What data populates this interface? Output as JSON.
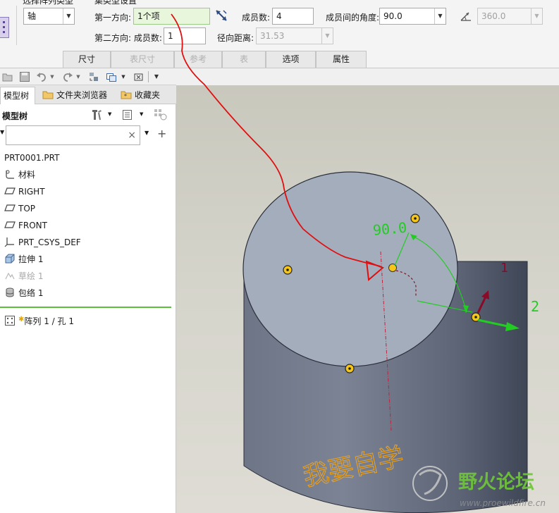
{
  "dashboard": {
    "pattern_type_label": "选择阵列类型",
    "pattern_type_value": "轴",
    "set_type_label": "集类型设置",
    "dir1_label": "第一方向:",
    "dir1_value": "1个项",
    "members_label": "成员数:",
    "members_value": "4",
    "angle_between_label": "成员间的角度:",
    "angle_between_value": "90.0",
    "total_angle_value": "360.0",
    "dir2_label": "第二方向: 成员数:",
    "dir2_members_value": "1",
    "radial_label": "径向距离:",
    "radial_value": "31.53",
    "tabs": [
      {
        "label": "尺寸",
        "enabled": true
      },
      {
        "label": "表尺寸",
        "enabled": false
      },
      {
        "label": "参考",
        "enabled": false
      },
      {
        "label": "表",
        "enabled": false
      },
      {
        "label": "选项",
        "enabled": true
      },
      {
        "label": "属性",
        "enabled": true
      }
    ]
  },
  "panel": {
    "tabs": [
      "模型树",
      "文件夹浏览器",
      "收藏夹"
    ],
    "title": "模型树",
    "search_placeholder": "",
    "tree": [
      {
        "label": "PRT0001.PRT",
        "icon": "part-icon",
        "dim": false
      },
      {
        "label": "材料",
        "icon": "material-icon",
        "dim": false
      },
      {
        "label": "RIGHT",
        "icon": "datum-plane-icon",
        "dim": false
      },
      {
        "label": "TOP",
        "icon": "datum-plane-icon",
        "dim": false
      },
      {
        "label": "FRONT",
        "icon": "datum-plane-icon",
        "dim": false
      },
      {
        "label": "PRT_CSYS_DEF",
        "icon": "csys-icon",
        "dim": false
      },
      {
        "label": "拉伸 1",
        "icon": "extrude-icon",
        "dim": false
      },
      {
        "label": "草绘 1",
        "icon": "sketch-icon",
        "dim": true
      },
      {
        "label": "包络 1",
        "icon": "wrap-icon",
        "dim": false
      },
      {
        "label": "阵列 1 / 孔 1",
        "icon": "pattern-icon",
        "dim": false
      }
    ]
  },
  "viewport": {
    "dim_angle": "90.0",
    "dir_label_1": "1",
    "dir_label_2": "2",
    "engraved_text": "我要自学",
    "watermark_name": "野火论坛",
    "watermark_url": "www.proewildfire.cn"
  },
  "colors": {
    "dim_green": "#22cc22",
    "annotation_red": "#e01010",
    "engrave_orange": "#e8a020",
    "cylinder_top": "#a2abba",
    "cylinder_side": "#5a6274"
  }
}
